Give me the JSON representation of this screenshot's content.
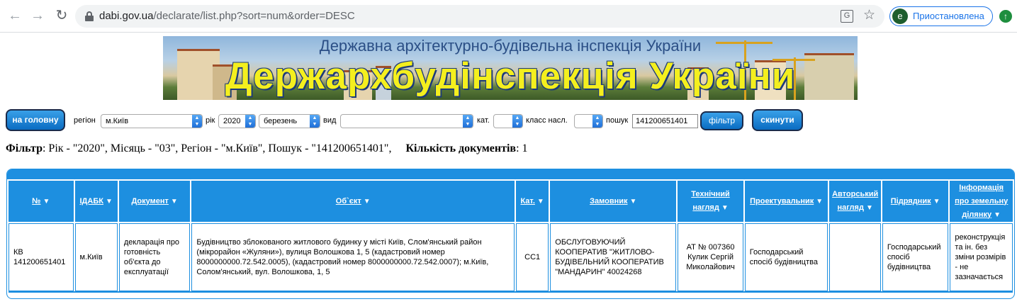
{
  "browser": {
    "url_host": "dabi.gov.ua",
    "url_path": "/declarate/list.php?sort=num&order=DESC",
    "profile_initial": "e",
    "profile_label": "Приостановлена"
  },
  "banner": {
    "subtitle": "Державна архітектурно-будівельна інспекція України",
    "title": "Держархбудінспекція України"
  },
  "filter": {
    "home_button": "на головну",
    "region_label": "регіон",
    "region_value": "м.Київ",
    "year_label": "рік",
    "year_value": "2020",
    "month_value": "березень",
    "type_label": "вид",
    "type_value": "",
    "category_label": "кат.",
    "category_value": "",
    "class_label": "класс насл.",
    "class_value": "",
    "search_label": "пошук",
    "search_value": "141200651401",
    "filter_button": "фільтр",
    "reset_button": "скинути"
  },
  "summary": {
    "filter_label": "Фільтр",
    "filter_text": ": Рік - \"2020\", Місяць - \"03\", Регіон - \"м.Київ\", Пошук - \"141200651401\",",
    "count_label": "Кількість документів",
    "count_value": ": 1"
  },
  "table": {
    "columns": [
      "№",
      "ІДАБК",
      "Документ",
      "Об`єкт",
      "Кат.",
      "Замовник",
      "Технічний нагляд",
      "Проектувальник",
      "Авторський нагляд",
      "Підрядник",
      "Інформація про земельну ділянку"
    ],
    "rows": [
      [
        "КВ 141200651401",
        "м.Київ",
        "декларація про готовність об'єкта до експлуатації",
        "Будівництво зблокованого житлового будинку у місті Київ, Слом'янський район (мікрорайон «Жуляни»), вулиця Волошкова 1, 5 (кадастровий номер 8000000000.72.542.0005), (кадастровий номер 8000000000.72.542.0007); м.Київ, Солом'янський, вул. Волошкова, 1, 5",
        "СС1",
        "ОБСЛУГОВУЮЧИЙ КООПЕРАТИВ \"ЖИТЛОВО-БУДІВЕЛЬНИЙ КООПЕРАТИВ \"МАНДАРИН\" 40024268",
        "АТ № 007360 Кулик Сергій Миколайович",
        "Господарський спосіб будівництва",
        "",
        "Господарський спосіб будівництва",
        "реконструкція та ін. без зміни розмірів - не зазначається"
      ]
    ]
  }
}
